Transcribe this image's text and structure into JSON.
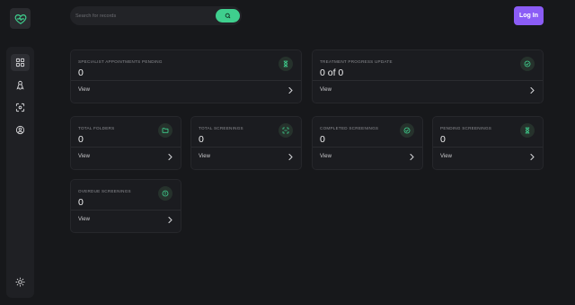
{
  "header": {
    "search_placeholder": "Search for records",
    "login_label": "Log In"
  },
  "icons": {
    "logo": "heart-logo-icon",
    "nav": [
      "dashboard-icon",
      "ribbon-icon",
      "scan-icon",
      "user-circle-icon"
    ],
    "theme": "sun-icon"
  },
  "colors": {
    "accent": "#3fcf8e",
    "primary_button": "#8b5cf6",
    "background": "#17181b",
    "card": "#1b1c20"
  },
  "cards": [
    {
      "label": "SPECIALIST APPOINTMENTS PENDING",
      "value": "0",
      "link": "View",
      "icon": "hourglass-icon"
    },
    {
      "label": "TREATMENT PROGRESS UPDATE",
      "value": "0 of 0",
      "link": "View",
      "icon": "check-circle-icon"
    },
    {
      "label": "TOTAL FOLDERS",
      "value": "0",
      "link": "View",
      "icon": "folder-icon"
    },
    {
      "label": "TOTAL SCREENINGS",
      "value": "0",
      "link": "View",
      "icon": "scan-icon"
    },
    {
      "label": "COMPLETED SCREENINGS",
      "value": "0",
      "link": "View",
      "icon": "check-circle-icon"
    },
    {
      "label": "PENDING SCREENINGS",
      "value": "0",
      "link": "View",
      "icon": "hourglass-icon"
    },
    {
      "label": "OVERDUE SCREENINGS",
      "value": "0",
      "link": "View",
      "icon": "alert-circle-icon"
    }
  ]
}
